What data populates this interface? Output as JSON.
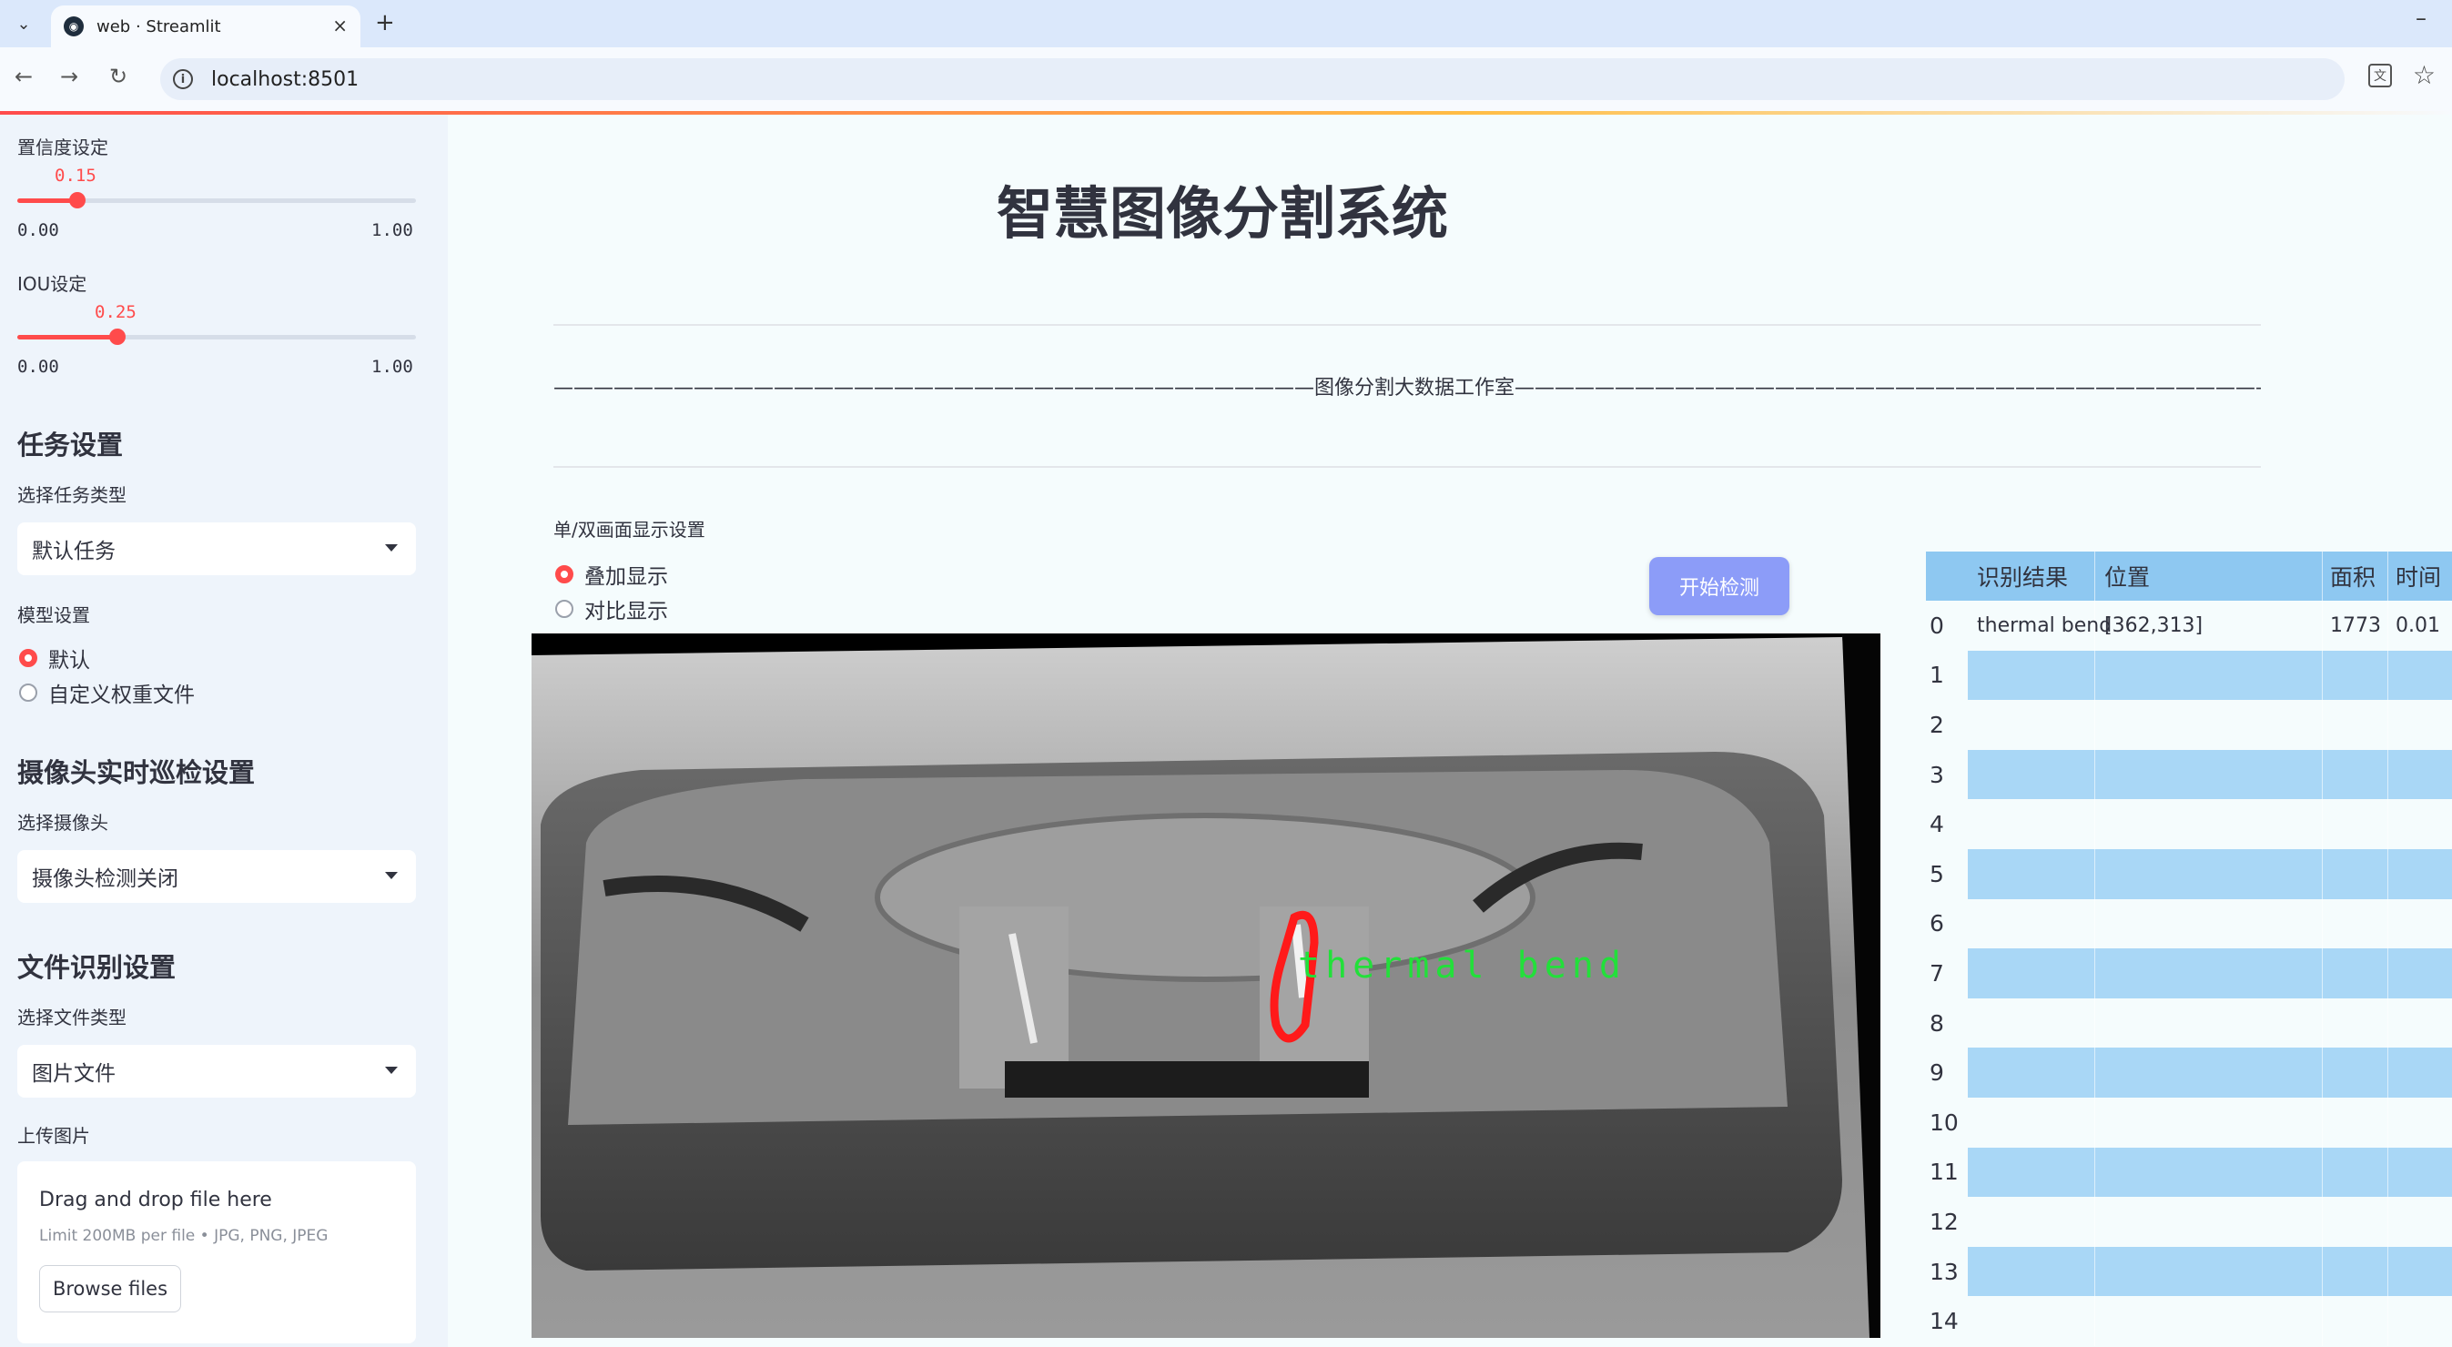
{
  "browser": {
    "tab_title": "web · Streamlit",
    "url": "localhost:8501",
    "new_tab": "+",
    "close": "×",
    "minimize": "–"
  },
  "sidebar": {
    "confidence": {
      "label": "置信度设定",
      "value": "0.15",
      "value_num": 0.15,
      "min": "0.00",
      "max": "1.00"
    },
    "iou": {
      "label": "IOU设定",
      "value": "0.25",
      "value_num": 0.25,
      "min": "0.00",
      "max": "1.00"
    },
    "task_settings": {
      "heading": "任务设置",
      "select_label": "选择任务类型",
      "select_value": "默认任务"
    },
    "model_settings": {
      "label": "模型设置",
      "options": [
        "默认",
        "自定义权重文件"
      ],
      "selected": 0
    },
    "camera": {
      "heading": "摄像头实时巡检设置",
      "select_label": "选择摄像头",
      "select_value": "摄像头检测关闭"
    },
    "file": {
      "heading": "文件识别设置",
      "select_label": "选择文件类型",
      "select_value": "图片文件",
      "upload_label": "上传图片"
    },
    "uploader": {
      "title": "Drag and drop file here",
      "subtitle": "Limit 200MB per file • JPG, PNG, JPEG",
      "button": "Browse files"
    }
  },
  "main": {
    "title": "智慧图像分割系统",
    "studio": "——————————————————————————————————————图像分割大数据工作室——————————————————————————————————————",
    "display_mode": {
      "label": "单/双画面显示设置",
      "options": [
        "叠加显示",
        "对比显示"
      ],
      "selected": 0
    },
    "start_button": "开始检测",
    "detection_label": "thermal  bend",
    "table": {
      "columns": [
        "识别结果",
        "位置",
        "面积",
        "时间"
      ],
      "rows": [
        {
          "idx": "0",
          "result": "thermal bend",
          "position": "[362,313]",
          "area": "1773",
          "time": "0.01"
        },
        {
          "idx": "1",
          "result": "",
          "position": "",
          "area": "",
          "time": ""
        },
        {
          "idx": "2",
          "result": "",
          "position": "",
          "area": "",
          "time": ""
        },
        {
          "idx": "3",
          "result": "",
          "position": "",
          "area": "",
          "time": ""
        },
        {
          "idx": "4",
          "result": "",
          "position": "",
          "area": "",
          "time": ""
        },
        {
          "idx": "5",
          "result": "",
          "position": "",
          "area": "",
          "time": ""
        },
        {
          "idx": "6",
          "result": "",
          "position": "",
          "area": "",
          "time": ""
        },
        {
          "idx": "7",
          "result": "",
          "position": "",
          "area": "",
          "time": ""
        },
        {
          "idx": "8",
          "result": "",
          "position": "",
          "area": "",
          "time": ""
        },
        {
          "idx": "9",
          "result": "",
          "position": "",
          "area": "",
          "time": ""
        },
        {
          "idx": "10",
          "result": "",
          "position": "",
          "area": "",
          "time": ""
        },
        {
          "idx": "11",
          "result": "",
          "position": "",
          "area": "",
          "time": ""
        },
        {
          "idx": "12",
          "result": "",
          "position": "",
          "area": "",
          "time": ""
        },
        {
          "idx": "13",
          "result": "",
          "position": "",
          "area": "",
          "time": ""
        },
        {
          "idx": "14",
          "result": "",
          "position": "",
          "area": "",
          "time": ""
        }
      ]
    }
  },
  "colors": {
    "accent": "#ff4b4b",
    "button": "#8c9cf8",
    "table_stripe": "#a9d7f6",
    "label_green": "#22e03a"
  }
}
